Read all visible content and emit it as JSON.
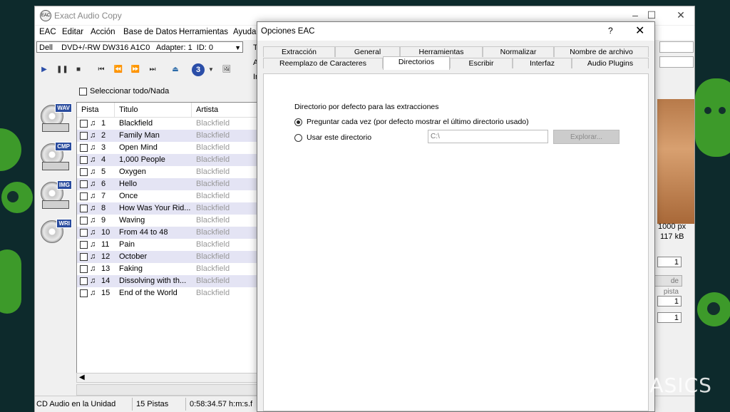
{
  "window": {
    "title": "Exact Audio Copy",
    "app_icon": "EAC",
    "controls": [
      "–",
      "☐",
      "✕"
    ]
  },
  "menu": [
    "EAC",
    "Editar",
    "Acción",
    "Base de Datos",
    "Herramientas",
    "Ayuda"
  ],
  "drive": {
    "selected": "Dell    DVD+/-RW DW316 A1C0   Adapter: 1  ID: 0"
  },
  "toolbar_icons": [
    "play-icon",
    "pause-icon",
    "stop-icon",
    "first-track-icon",
    "previous-icon",
    "next-icon",
    "last-track-icon",
    "eject-icon",
    "cd-text-icon",
    "chevron-down-icon",
    "drive-options-icon"
  ],
  "cdtext_label": "3",
  "select_all_label": "Seleccionar todo/Nada",
  "side_tools": [
    "WAV",
    "CMP",
    "IMG",
    "WRI"
  ],
  "tracklist": {
    "headers": [
      "Pista",
      "Titulo",
      "Artista"
    ],
    "rows": [
      {
        "num": "1",
        "title": "Blackfield",
        "artist": "Blackfield"
      },
      {
        "num": "2",
        "title": "Family Man",
        "artist": "Blackfield"
      },
      {
        "num": "3",
        "title": "Open Mind",
        "artist": "Blackfield"
      },
      {
        "num": "4",
        "title": "1,000 People",
        "artist": "Blackfield"
      },
      {
        "num": "5",
        "title": "Oxygen",
        "artist": "Blackfield"
      },
      {
        "num": "6",
        "title": "Hello",
        "artist": "Blackfield"
      },
      {
        "num": "7",
        "title": "Once",
        "artist": "Blackfield"
      },
      {
        "num": "8",
        "title": "How Was Your Rid...",
        "artist": "Blackfield"
      },
      {
        "num": "9",
        "title": "Waving",
        "artist": "Blackfield"
      },
      {
        "num": "10",
        "title": "From 44 to 48",
        "artist": "Blackfield"
      },
      {
        "num": "11",
        "title": "Pain",
        "artist": "Blackfield"
      },
      {
        "num": "12",
        "title": "October",
        "artist": "Blackfield"
      },
      {
        "num": "13",
        "title": "Faking",
        "artist": "Blackfield"
      },
      {
        "num": "14",
        "title": "Dissolving with th...",
        "artist": "Blackfield"
      },
      {
        "num": "15",
        "title": "End of the World",
        "artist": "Blackfield"
      }
    ]
  },
  "status": {
    "source": "CD Audio en la Unidad",
    "tracks": "15 Pistas",
    "duration": "0:58:34.57 h:m:s.f"
  },
  "right_panel": {
    "partial_labels": [
      "T",
      "A",
      "In"
    ],
    "image_size": "1000 px",
    "file_size": "117 kB",
    "box1": "1",
    "button_partial": "de pista",
    "box2": "1",
    "box3": "1"
  },
  "dialog": {
    "title": "Opciones EAC",
    "help": "?",
    "close": "✕",
    "tabs_row1": [
      "Extracción",
      "General",
      "Herramientas",
      "Normalizar",
      "Nombre de archivo"
    ],
    "tabs_row2": [
      "Reemplazo de Caracteres",
      "Directorios",
      "Escribir",
      "Interfaz",
      "Audio Plugins"
    ],
    "active_tab": "Directorios",
    "group_label": "Directorio por defecto para las extracciones",
    "option_ask": "Preguntar cada vez (por defecto mostrar el último directorio usado)",
    "option_use": "Usar este directorio",
    "selected_option": "option_ask",
    "path_value": "C:\\",
    "browse_label": "Explorar..."
  },
  "watermark": "XATAKA BASICS"
}
